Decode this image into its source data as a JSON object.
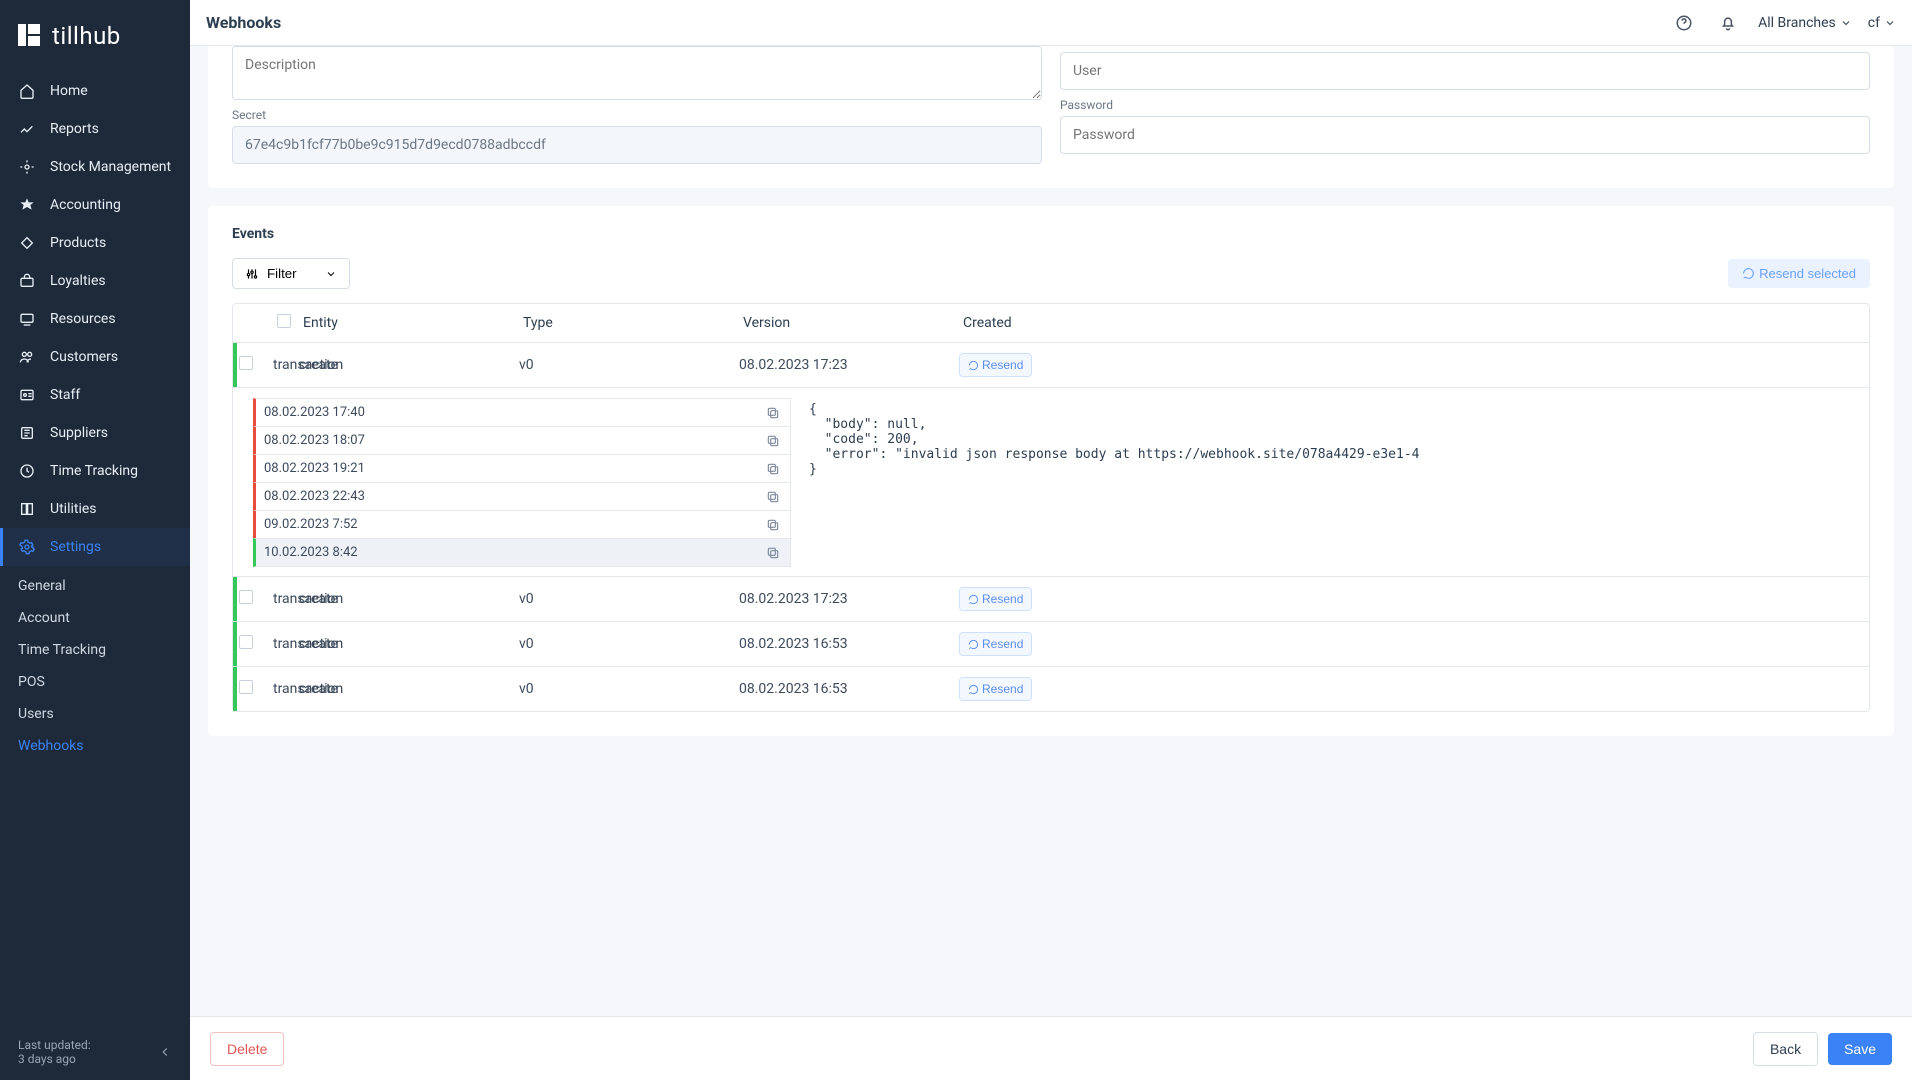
{
  "brand": "tillhub",
  "header": {
    "title": "Webhooks",
    "branches_label": "All Branches",
    "user_short": "cf"
  },
  "sidebar": {
    "items": [
      {
        "label": "Home",
        "icon": "home-icon"
      },
      {
        "label": "Reports",
        "icon": "reports-icon"
      },
      {
        "label": "Stock Management",
        "icon": "stock-icon"
      },
      {
        "label": "Accounting",
        "icon": "accounting-icon"
      },
      {
        "label": "Products",
        "icon": "products-icon"
      },
      {
        "label": "Loyalties",
        "icon": "loyalties-icon"
      },
      {
        "label": "Resources",
        "icon": "resources-icon"
      },
      {
        "label": "Customers",
        "icon": "customers-icon"
      },
      {
        "label": "Staff",
        "icon": "staff-icon"
      },
      {
        "label": "Suppliers",
        "icon": "suppliers-icon"
      },
      {
        "label": "Time Tracking",
        "icon": "time-icon"
      },
      {
        "label": "Utilities",
        "icon": "utilities-icon"
      },
      {
        "label": "Settings",
        "icon": "settings-icon",
        "active": true
      }
    ],
    "subitems": [
      {
        "label": "General"
      },
      {
        "label": "Account"
      },
      {
        "label": "Time Tracking"
      },
      {
        "label": "POS"
      },
      {
        "label": "Users"
      },
      {
        "label": "Webhooks",
        "active": true
      }
    ],
    "footer": {
      "line1": "Last updated:",
      "line2": "3 days ago"
    }
  },
  "form": {
    "description_placeholder": "Description",
    "secret_label": "Secret",
    "secret_value": "67e4c9b1fcf77b0be9c915d7d9ecd0788adbccdf",
    "user_placeholder": "User",
    "password_label": "Password",
    "password_placeholder": "Password"
  },
  "events": {
    "title": "Events",
    "filter_label": "Filter",
    "resend_selected_label": "Resend selected",
    "columns": {
      "entity": "Entity",
      "type": "Type",
      "version": "Version",
      "created": "Created"
    },
    "resend_label": "Resend",
    "rows": [
      {
        "entity": "transaction",
        "type": "create",
        "version": "v0",
        "created": "08.02.2023 17:23"
      },
      {
        "entity": "transaction",
        "type": "create",
        "version": "v0",
        "created": "08.02.2023 17:23"
      },
      {
        "entity": "transaction",
        "type": "create",
        "version": "v0",
        "created": "08.02.2023 16:53"
      },
      {
        "entity": "transaction",
        "type": "create",
        "version": "v0",
        "created": "08.02.2023 16:53"
      }
    ],
    "attempts": [
      {
        "ts": "08.02.2023 17:40",
        "ok": false
      },
      {
        "ts": "08.02.2023 18:07",
        "ok": false
      },
      {
        "ts": "08.02.2023 19:21",
        "ok": false
      },
      {
        "ts": "08.02.2023 22:43",
        "ok": false
      },
      {
        "ts": "09.02.2023 7:52",
        "ok": false
      },
      {
        "ts": "10.02.2023 8:42",
        "ok": true,
        "selected": true
      }
    ],
    "response_json": "{\n  \"body\": null,\n  \"code\": 200,\n  \"error\": \"invalid json response body at https://webhook.site/078a4429-e3e1-4\n}"
  },
  "footer": {
    "delete": "Delete",
    "back": "Back",
    "save": "Save"
  }
}
